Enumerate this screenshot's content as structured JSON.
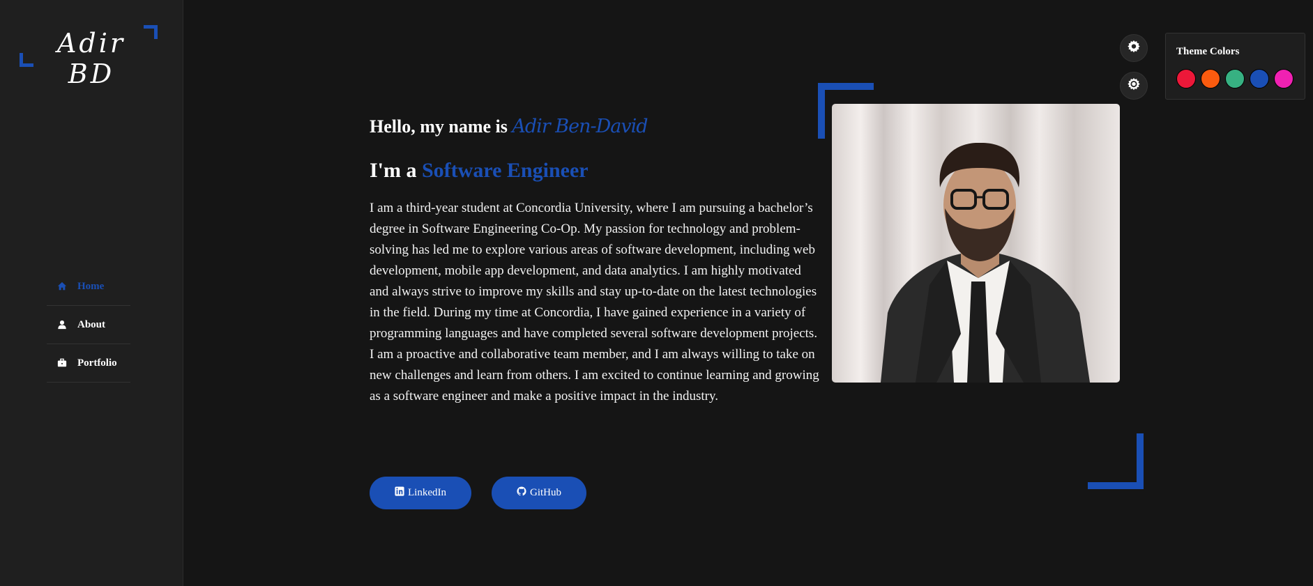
{
  "logo": {
    "text": "Adir BD",
    "accent_color": "#1a4fb5"
  },
  "nav": {
    "items": [
      {
        "label": "Home",
        "icon": "home-icon",
        "active": true
      },
      {
        "label": "About",
        "icon": "user-icon",
        "active": false
      },
      {
        "label": "Portfolio",
        "icon": "briefcase-icon",
        "active": false
      }
    ]
  },
  "hero": {
    "greeting": "Hello, my name is",
    "name": "Adir Ben-David",
    "role_prefix": "I'm a",
    "role": "Software Engineer",
    "bio": "I am a third-year student at Concordia University, where I am pursuing a bachelor’s degree in Software Engineering Co-Op. My passion for technology and problem-solving has led me to explore various areas of software development, including web development, mobile app development, and data analytics. I am highly motivated and always strive to improve my skills and stay up-to-date on the latest technologies in the field. During my time at Concordia, I have gained experience in a variety of programming languages and have completed several software development projects. I am a proactive and collaborative team member, and I am always willing to take on new challenges and learn from others. I am excited to continue learning and growing as a software engineer and make a positive impact in the industry.",
    "buttons": {
      "linkedin": "LinkedIn",
      "github": "GitHub"
    }
  },
  "theme": {
    "title": "Theme Colors",
    "colors": [
      "#ec1839",
      "#fa5b0f",
      "#37b182",
      "#1a4fb5",
      "#f021b2"
    ],
    "accent": "#1a4fb5",
    "background": "#151515"
  }
}
